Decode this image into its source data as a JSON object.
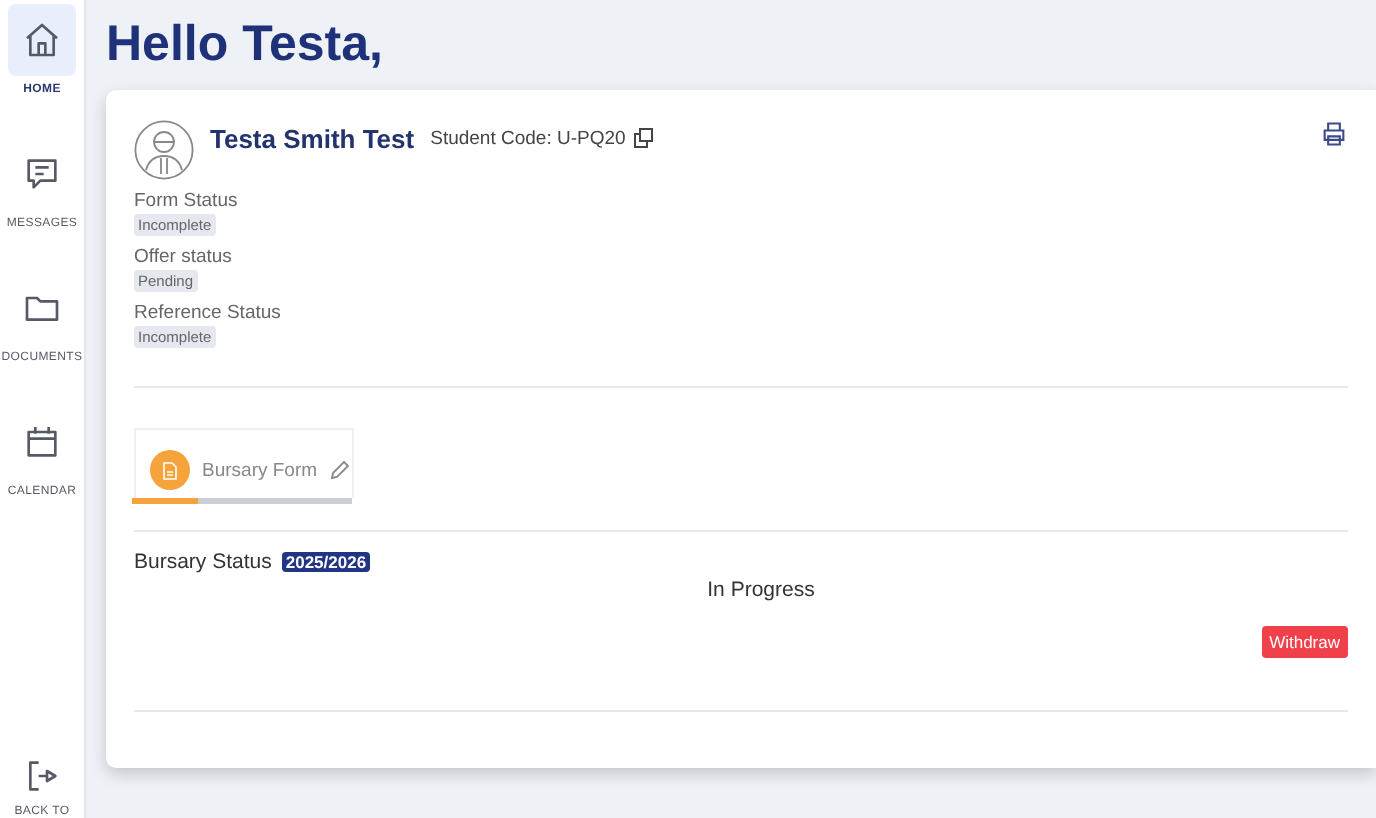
{
  "sidebar": {
    "items": [
      {
        "kind": "home",
        "label": "HOME",
        "selected": true
      },
      {
        "kind": "messages",
        "label": "MESSAGES",
        "selected": false
      },
      {
        "kind": "documents",
        "label": "DOCUMENTS",
        "selected": false
      },
      {
        "kind": "calendar",
        "label": "CALENDAR",
        "selected": false
      }
    ],
    "footer": {
      "kind": "back",
      "label": "BACK TO"
    }
  },
  "greeting": "Hello Testa,",
  "profile": {
    "name": "Testa Smith Test",
    "student_code": "Student Code: U-PQ20"
  },
  "statuses": [
    {
      "label": "Form Status",
      "value": "Incomplete"
    },
    {
      "label": "Offer status",
      "value": "Pending"
    },
    {
      "label": "Reference Status",
      "value": "Incomplete"
    }
  ],
  "form_card": {
    "title": "Bursary Form",
    "level": 0.3
  },
  "bursary": {
    "label": "Bursary Status",
    "year": "2025/2026",
    "status": "In Progress",
    "action": "Withdraw"
  }
}
